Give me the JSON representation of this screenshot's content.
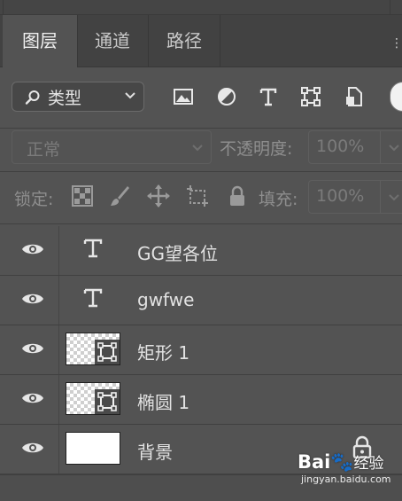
{
  "tabs": [
    {
      "label": "图层",
      "active": true
    },
    {
      "label": "通道",
      "active": false
    },
    {
      "label": "路径",
      "active": false
    }
  ],
  "filter": {
    "kind_label": "类型",
    "icons": [
      "image-filter-icon",
      "adjustment-filter-icon",
      "type-filter-icon",
      "shape-filter-icon",
      "smart-object-filter-icon"
    ]
  },
  "blend": {
    "mode": "正常",
    "opacity_label": "不透明度:",
    "opacity_value": "100%"
  },
  "lock": {
    "label": "锁定:",
    "fill_label": "填充:",
    "fill_value": "100%"
  },
  "layers": [
    {
      "name": "GG望各位",
      "kind": "text",
      "visible": true
    },
    {
      "name": "gwfwe",
      "kind": "text",
      "visible": true
    },
    {
      "name": "矩形 1",
      "kind": "shape",
      "visible": true
    },
    {
      "name": "椭圆 1",
      "kind": "shape",
      "visible": true
    },
    {
      "name": "背景",
      "kind": "background",
      "visible": true,
      "locked": true
    }
  ],
  "watermark": {
    "brand_a": "Bai",
    "brand_b": "经验",
    "url": "jingyan.baidu.com"
  },
  "colors": {
    "panel": "#535353",
    "tabbar": "#424242",
    "text": "#e2e2e2"
  }
}
